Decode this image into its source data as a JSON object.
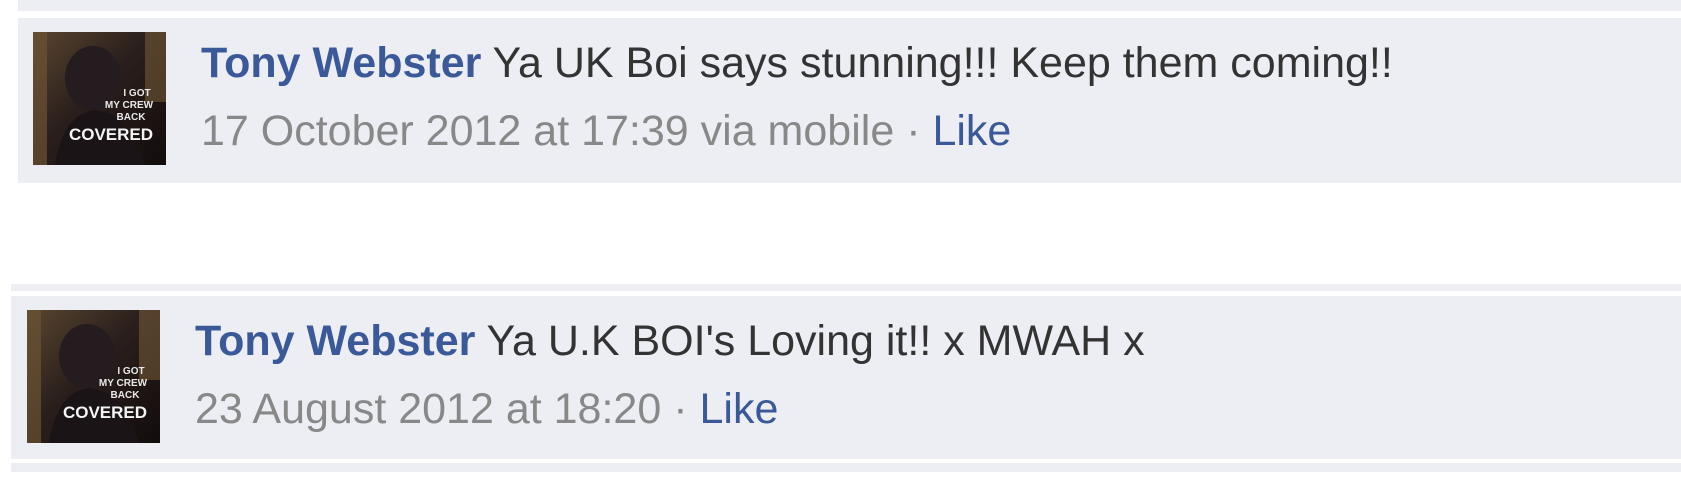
{
  "comments": [
    {
      "author": "Tony Webster",
      "text": "Ya UK Boi says stunning!!! Keep them coming!!",
      "timestamp": "17 October 2012 at 17:39 via mobile",
      "separator": "·",
      "like_label": "Like",
      "avatar_caption": "I GOT MY CREW BACK COVERED"
    },
    {
      "author": "Tony Webster",
      "text": "Ya U.K BOI's Loving it!! x MWAH x",
      "timestamp": "23 August 2012 at 18:20",
      "separator": "·",
      "like_label": "Like",
      "avatar_caption": "I GOT MY CREW BACK COVERED"
    }
  ],
  "colors": {
    "author_link": "#3b5998",
    "comment_bg": "#eceef4",
    "body_text": "#333333",
    "meta_text": "#888888"
  }
}
